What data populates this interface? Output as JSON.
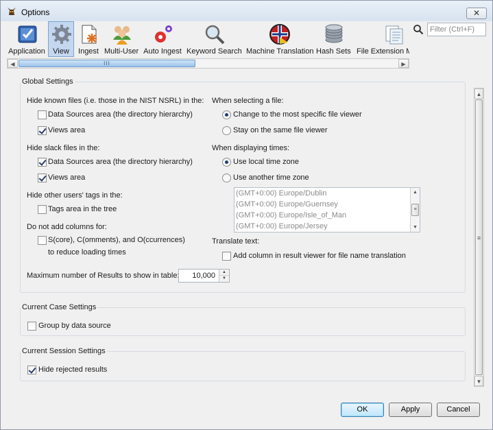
{
  "window": {
    "title": "Options",
    "close_label": "✕"
  },
  "toolbar": {
    "items": [
      {
        "label": "Application",
        "icon": "application-icon"
      },
      {
        "label": "View",
        "icon": "gear-icon",
        "selected": true
      },
      {
        "label": "Ingest",
        "icon": "ingest-icon"
      },
      {
        "label": "Multi-User",
        "icon": "users-icon"
      },
      {
        "label": "Auto Ingest",
        "icon": "auto-ingest-icon"
      },
      {
        "label": "Keyword Search",
        "icon": "magnifier-icon"
      },
      {
        "label": "Machine Translation",
        "icon": "globe-flag-icon"
      },
      {
        "label": "Hash Sets",
        "icon": "database-icon"
      },
      {
        "label": "File Extension Mi",
        "icon": "file-extension-icon"
      }
    ],
    "filter_placeholder": "Filter (Ctrl+F)"
  },
  "global_settings": {
    "title": "Global Settings",
    "hide_known": {
      "label": "Hide known files (i.e. those in the NIST NSRL) in the:",
      "data_sources": {
        "label": "Data Sources area (the directory hierarchy)",
        "checked": false
      },
      "views": {
        "label": "Views area",
        "checked": true
      }
    },
    "hide_slack": {
      "label": "Hide slack files in the:",
      "data_sources": {
        "label": "Data Sources area (the directory hierarchy)",
        "checked": true
      },
      "views": {
        "label": "Views area",
        "checked": true
      }
    },
    "hide_tags": {
      "label": "Hide other users' tags in the:",
      "tags_area": {
        "label": "Tags area in the tree",
        "checked": false
      }
    },
    "no_columns": {
      "label": "Do not add columns for:",
      "scc": {
        "label_line1": "S(core), C(omments), and O(ccurrences)",
        "label_line2": "to reduce loading times",
        "checked": false
      }
    },
    "max_results": {
      "label": "Maximum number of Results to show in table:",
      "value": "10,000"
    },
    "selecting_file": {
      "label": "When selecting a file:",
      "most_specific": {
        "label": "Change to the most specific file viewer",
        "checked": true
      },
      "same_viewer": {
        "label": "Stay on the same file viewer",
        "checked": false
      }
    },
    "displaying_times": {
      "label": "When displaying times:",
      "local": {
        "label": "Use local time zone",
        "checked": true
      },
      "another": {
        "label": "Use another time zone",
        "checked": false
      },
      "timezones": [
        "(GMT+0:00) Europe/Dublin",
        "(GMT+0:00) Europe/Guernsey",
        "(GMT+0:00) Europe/Isle_of_Man",
        "(GMT+0:00) Europe/Jersey"
      ]
    },
    "translate": {
      "label": "Translate text:",
      "add_column": {
        "label": "Add column in result viewer for file name translation",
        "checked": false
      }
    }
  },
  "case_settings": {
    "title": "Current Case Settings",
    "group_by": {
      "label": "Group by data source",
      "checked": false
    }
  },
  "session_settings": {
    "title": "Current Session Settings",
    "hide_rejected": {
      "label": "Hide rejected results",
      "checked": true
    }
  },
  "buttons": {
    "ok": "OK",
    "apply": "Apply",
    "cancel": "Cancel"
  },
  "colors": {
    "selected_tab": "#c3d7ef",
    "default_button": "#bee6fd"
  }
}
